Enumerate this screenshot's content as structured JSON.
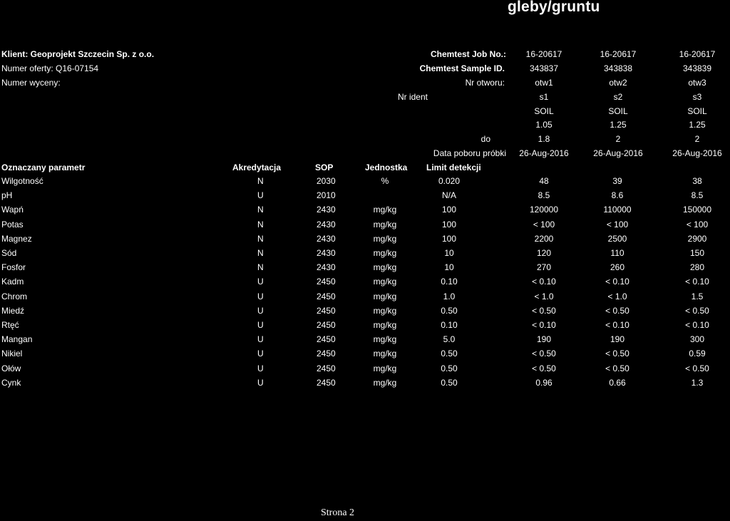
{
  "page_title": "gleby/gruntu",
  "client": {
    "client_line": "Klient: Geoprojekt Szczecin Sp. z o.o.",
    "offer_line": "Numer oferty: Q16-07154",
    "quote_line": "Numer wyceny:"
  },
  "header_labels": {
    "job_no": "Chemtest Job No.:",
    "sample_id": "Chemtest Sample ID.",
    "borehole": "Nr otworu:",
    "ident": "Nr ident",
    "do": "do",
    "sampling_date": "Data poboru próbki"
  },
  "samples": [
    {
      "job_no": "16-20617",
      "sample_id": "343837",
      "borehole": "otw1",
      "ident": "s1",
      "matrix": "SOIL",
      "depth_from": "1.05",
      "depth_to": "1.8",
      "date": "26-Aug-2016"
    },
    {
      "job_no": "16-20617",
      "sample_id": "343838",
      "borehole": "otw2",
      "ident": "s2",
      "matrix": "SOIL",
      "depth_from": "1.25",
      "depth_to": "2",
      "date": "26-Aug-2016"
    },
    {
      "job_no": "16-20617",
      "sample_id": "343839",
      "borehole": "otw3",
      "ident": "s3",
      "matrix": "SOIL",
      "depth_from": "1.25",
      "depth_to": "2",
      "date": "26-Aug-2016"
    }
  ],
  "columns": {
    "parameter": "Oznaczany parametr",
    "accreditation": "Akredytacja",
    "sop": "SOP",
    "unit": "Jednostka",
    "lod": "Limit detekcji"
  },
  "rows": [
    {
      "param": "Wilgotność",
      "acc": "N",
      "sop": "2030",
      "unit": "%",
      "lod": "0.020",
      "v": [
        "48",
        "39",
        "38"
      ]
    },
    {
      "param": "pH",
      "acc": "U",
      "sop": "2010",
      "unit": "",
      "lod": "N/A",
      "v": [
        "8.5",
        "8.6",
        "8.5"
      ]
    },
    {
      "param": "Wapń",
      "acc": "N",
      "sop": "2430",
      "unit": "mg/kg",
      "lod": "100",
      "v": [
        "120000",
        "110000",
        "150000"
      ]
    },
    {
      "param": "Potas",
      "acc": "N",
      "sop": "2430",
      "unit": "mg/kg",
      "lod": "100",
      "v": [
        "< 100",
        "< 100",
        "< 100"
      ]
    },
    {
      "param": "Magnez",
      "acc": "N",
      "sop": "2430",
      "unit": "mg/kg",
      "lod": "100",
      "v": [
        "2200",
        "2500",
        "2900"
      ]
    },
    {
      "param": "Sód",
      "acc": "N",
      "sop": "2430",
      "unit": "mg/kg",
      "lod": "10",
      "v": [
        "120",
        "110",
        "150"
      ]
    },
    {
      "param": "Fosfor",
      "acc": "N",
      "sop": "2430",
      "unit": "mg/kg",
      "lod": "10",
      "v": [
        "270",
        "260",
        "280"
      ]
    },
    {
      "param": "Kadm",
      "acc": "U",
      "sop": "2450",
      "unit": "mg/kg",
      "lod": "0.10",
      "v": [
        "< 0.10",
        "< 0.10",
        "< 0.10"
      ]
    },
    {
      "param": "Chrom",
      "acc": "U",
      "sop": "2450",
      "unit": "mg/kg",
      "lod": "1.0",
      "v": [
        "< 1.0",
        "< 1.0",
        "1.5"
      ]
    },
    {
      "param": "Miedź",
      "acc": "U",
      "sop": "2450",
      "unit": "mg/kg",
      "lod": "0.50",
      "v": [
        "< 0.50",
        "< 0.50",
        "< 0.50"
      ]
    },
    {
      "param": "Rtęć",
      "acc": "U",
      "sop": "2450",
      "unit": "mg/kg",
      "lod": "0.10",
      "v": [
        "< 0.10",
        "< 0.10",
        "< 0.10"
      ]
    },
    {
      "param": "Mangan",
      "acc": "U",
      "sop": "2450",
      "unit": "mg/kg",
      "lod": "5.0",
      "v": [
        "190",
        "190",
        "300"
      ]
    },
    {
      "param": "Nikiel",
      "acc": "U",
      "sop": "2450",
      "unit": "mg/kg",
      "lod": "0.50",
      "v": [
        "< 0.50",
        "< 0.50",
        "0.59"
      ]
    },
    {
      "param": "Ołów",
      "acc": "U",
      "sop": "2450",
      "unit": "mg/kg",
      "lod": "0.50",
      "v": [
        "< 0.50",
        "< 0.50",
        "< 0.50"
      ]
    },
    {
      "param": "Cynk",
      "acc": "U",
      "sop": "2450",
      "unit": "mg/kg",
      "lod": "0.50",
      "v": [
        "0.96",
        "0.66",
        "1.3"
      ]
    }
  ],
  "footer": "Strona 2"
}
